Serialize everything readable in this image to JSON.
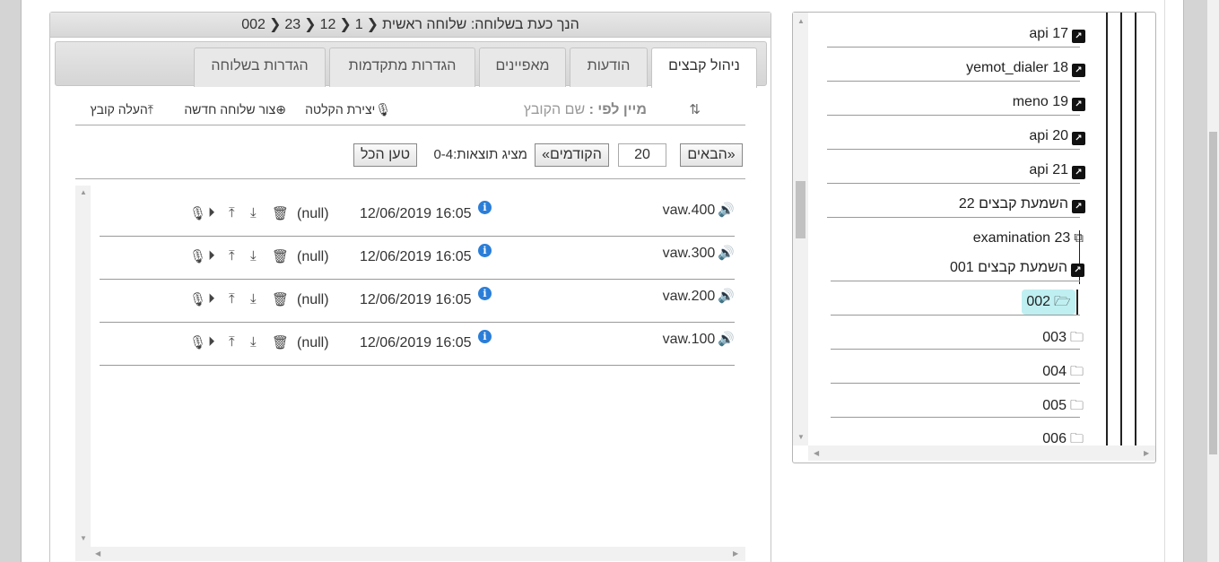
{
  "header": {
    "title_prefix": "הנך כעת בשלוחה:",
    "crumbs": [
      "שלוחה ראשית",
      "1",
      "12",
      "23",
      "002"
    ]
  },
  "tabs": [
    {
      "label": "ניהול קבצים",
      "active": true
    },
    {
      "label": "הודעות",
      "active": false
    },
    {
      "label": "מאפיינים",
      "active": false
    },
    {
      "label": "הגדרות מתקדמות",
      "active": false
    },
    {
      "label": "הגדרות בשלוחה",
      "active": false
    }
  ],
  "toolbar": {
    "sort_label": "מיין לפי :",
    "sort_value": "שם הקובץ",
    "create_recording": "יצירת הקלטה",
    "create_extension": "צור שלוחה חדשה",
    "upload_file": "העלה קובץ"
  },
  "pager": {
    "next_label": "«הבאים",
    "page_size": "20",
    "prev_label": "הקודמים»",
    "status": "מציג תוצאות:0-4",
    "load_all": "טען הכל"
  },
  "files": [
    {
      "name": "004.wav",
      "date": "12/06/2019 16:05",
      "size": "(null)"
    },
    {
      "name": "003.wav",
      "date": "12/06/2019 16:05",
      "size": "(null)"
    },
    {
      "name": "002.wav",
      "date": "12/06/2019 16:05",
      "size": "(null)"
    },
    {
      "name": "001.wav",
      "date": "12/06/2019 16:05",
      "size": "(null)"
    }
  ],
  "tree": {
    "items": [
      {
        "num": "17",
        "label": "api",
        "icon": "external-link-square-icon"
      },
      {
        "num": "18",
        "label": "yemot_dialer",
        "icon": "external-link-square-icon"
      },
      {
        "num": "19",
        "label": "meno",
        "icon": "external-link-square-icon"
      },
      {
        "num": "20",
        "label": "api",
        "icon": "external-link-square-icon"
      },
      {
        "num": "21",
        "label": "api",
        "icon": "external-link-square-icon"
      },
      {
        "num": "22",
        "label": "השמעת קבצים",
        "icon": "external-link-square-icon"
      },
      {
        "num": "23",
        "label": "examination",
        "icon": "external-link-icon"
      },
      {
        "num": "001",
        "label": "השמעת קבצים",
        "icon": "external-link-square-icon"
      },
      {
        "num": "002",
        "label": "",
        "icon": "folder-open-icon",
        "selected": true
      },
      {
        "num": "003",
        "label": "",
        "icon": "folder-icon"
      },
      {
        "num": "004",
        "label": "",
        "icon": "folder-icon"
      },
      {
        "num": "005",
        "label": "",
        "icon": "folder-icon"
      },
      {
        "num": "006",
        "label": "",
        "icon": "folder-icon"
      }
    ]
  },
  "colors": {
    "selected_node_bg": "#bfeff1",
    "info_icon": "#2a7ed8"
  }
}
